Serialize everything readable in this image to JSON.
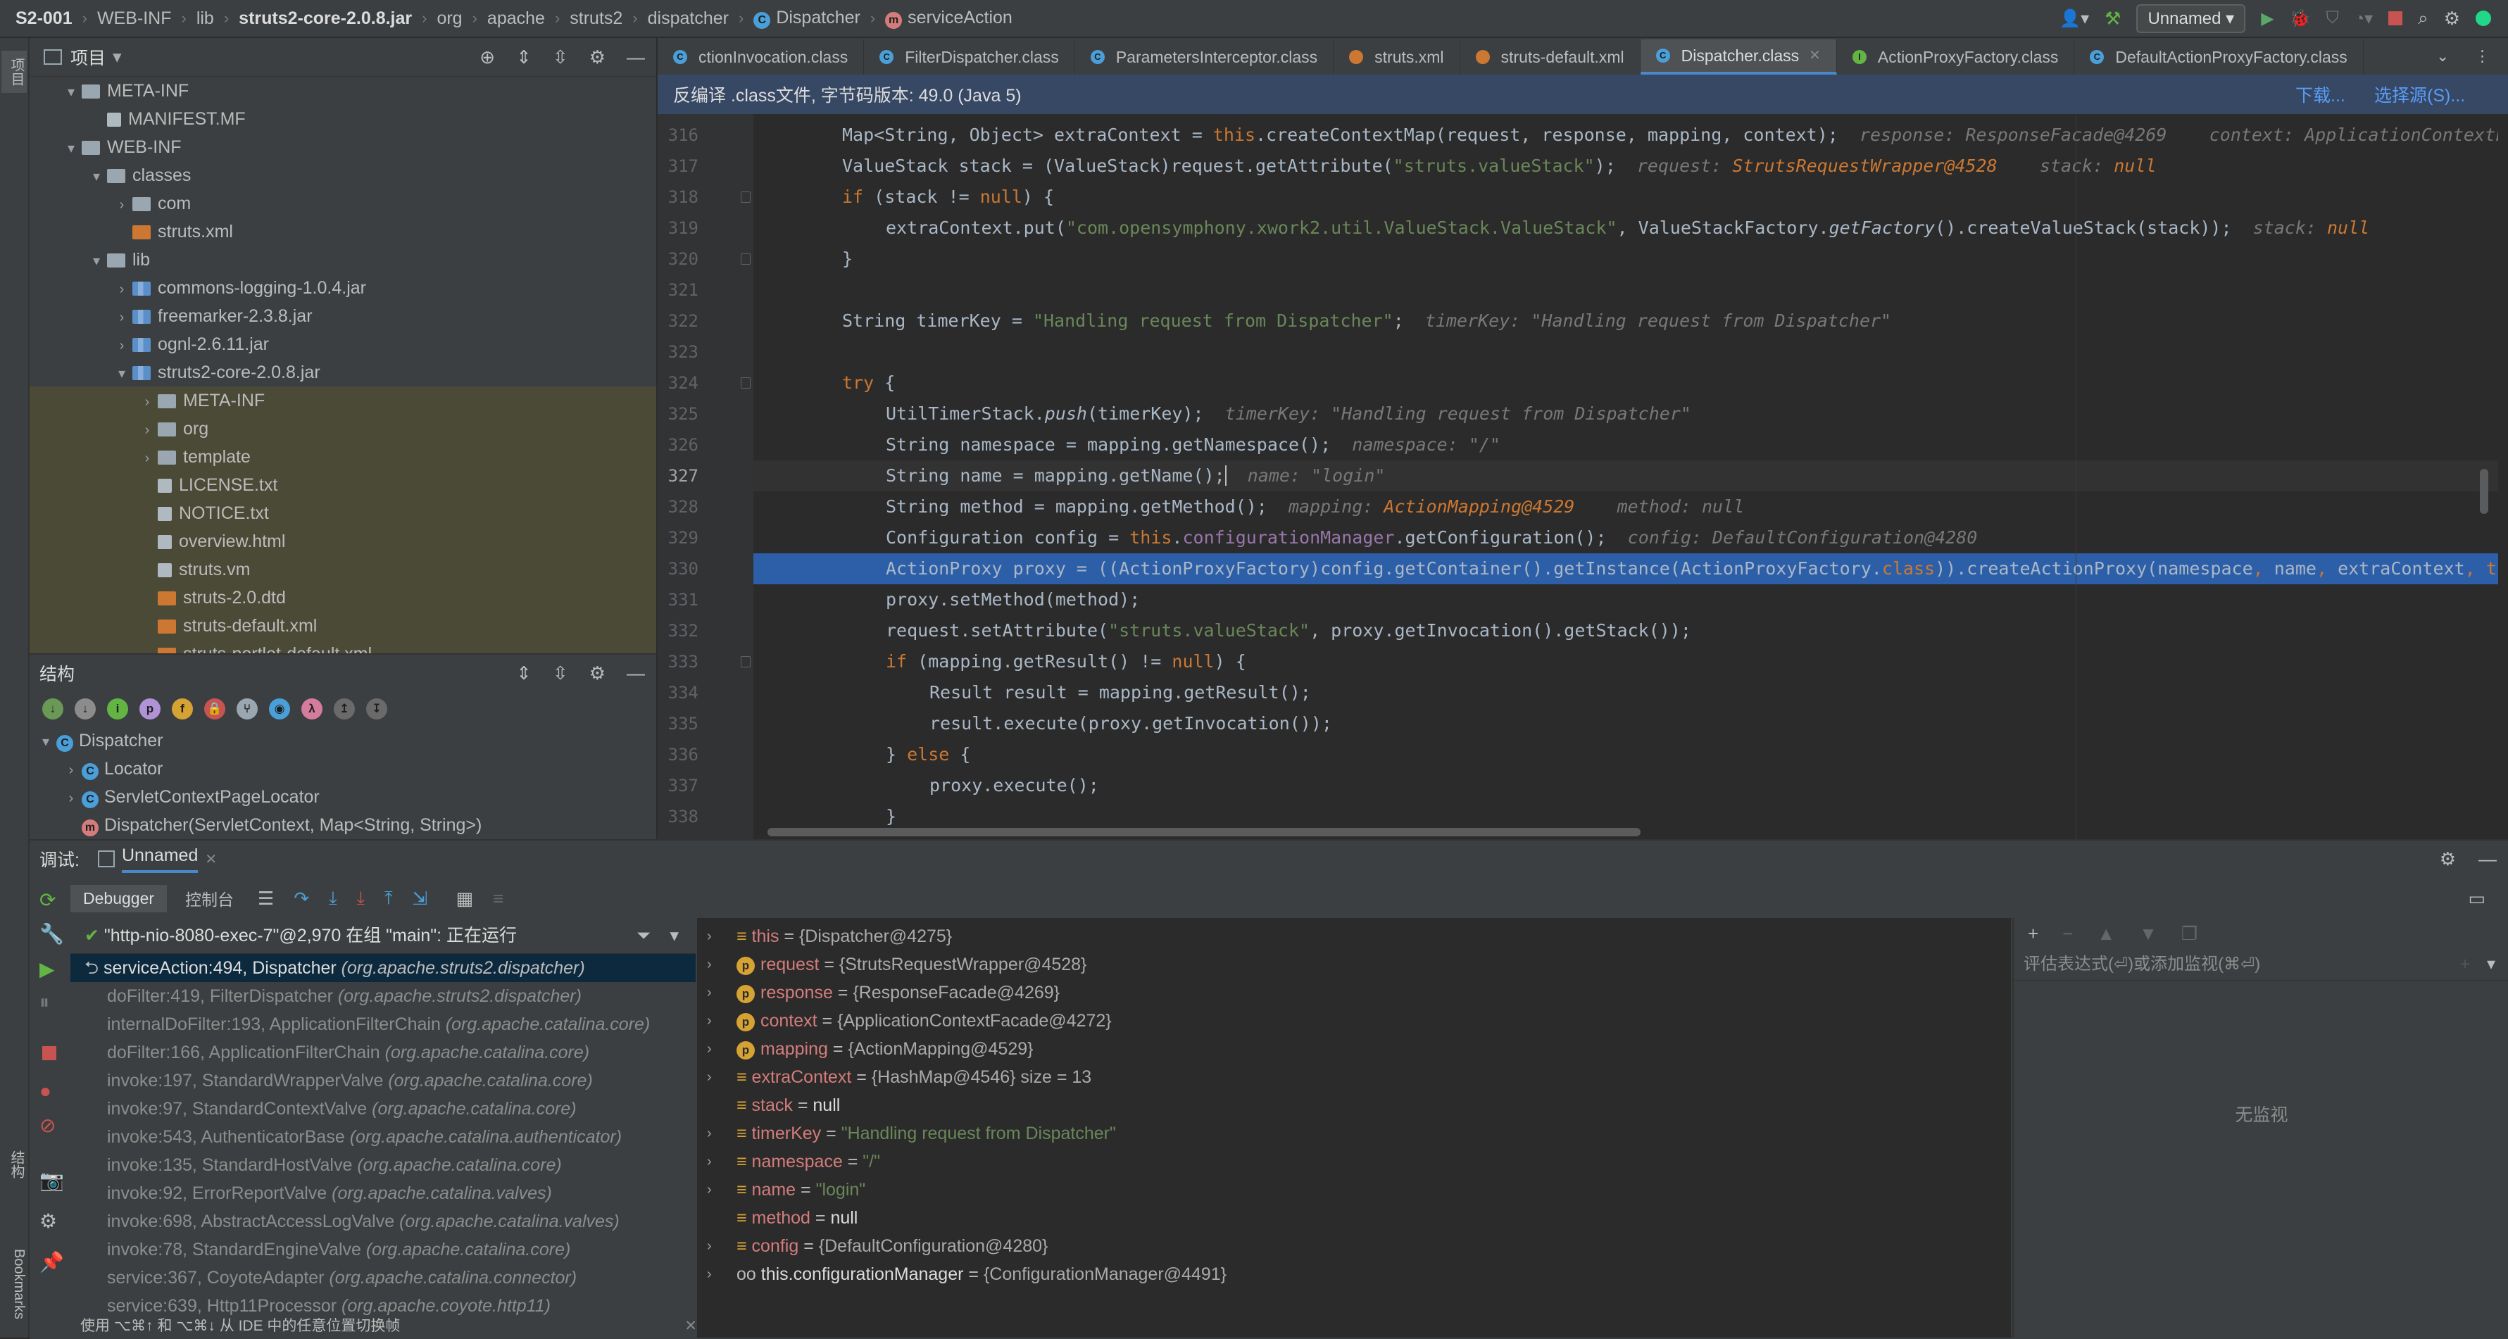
{
  "navbar": {
    "crumbs": [
      "S2-001",
      "WEB-INF",
      "lib",
      "struts2-core-2.0.8.jar",
      "org",
      "apache",
      "struts2",
      "dispatcher",
      "Dispatcher",
      "serviceAction"
    ],
    "run_config": "Unnamed"
  },
  "left_strip": {
    "project_label": "项目",
    "structure_label": "结构",
    "bookmarks_label": "Bookmarks"
  },
  "project": {
    "title": "项目",
    "tree": [
      {
        "label": "META-INF",
        "type": "folder",
        "depth": 1,
        "arrow": "▾"
      },
      {
        "label": "MANIFEST.MF",
        "type": "txt",
        "depth": 2,
        "arrow": ""
      },
      {
        "label": "WEB-INF",
        "type": "folder",
        "depth": 1,
        "arrow": "▾"
      },
      {
        "label": "classes",
        "type": "folder",
        "depth": 2,
        "arrow": "▾"
      },
      {
        "label": "com",
        "type": "folder",
        "depth": 3,
        "arrow": "›"
      },
      {
        "label": "struts.xml",
        "type": "xml",
        "depth": 3,
        "arrow": ""
      },
      {
        "label": "lib",
        "type": "folder",
        "depth": 2,
        "arrow": "▾"
      },
      {
        "label": "commons-logging-1.0.4.jar",
        "type": "jar",
        "depth": 3,
        "arrow": "›"
      },
      {
        "label": "freemarker-2.3.8.jar",
        "type": "jar",
        "depth": 3,
        "arrow": "›"
      },
      {
        "label": "ognl-2.6.11.jar",
        "type": "jar",
        "depth": 3,
        "arrow": "›"
      },
      {
        "label": "struts2-core-2.0.8.jar",
        "type": "jar",
        "depth": 3,
        "arrow": "▾"
      },
      {
        "label": "META-INF",
        "type": "folder",
        "depth": 4,
        "arrow": "›",
        "hl": true
      },
      {
        "label": "org",
        "type": "folder",
        "depth": 4,
        "arrow": "›",
        "hl": true
      },
      {
        "label": "template",
        "type": "folder",
        "depth": 4,
        "arrow": "›",
        "hl": true
      },
      {
        "label": "LICENSE.txt",
        "type": "txt",
        "depth": 4,
        "arrow": "",
        "hl": true
      },
      {
        "label": "NOTICE.txt",
        "type": "txt",
        "depth": 4,
        "arrow": "",
        "hl": true
      },
      {
        "label": "overview.html",
        "type": "txt",
        "depth": 4,
        "arrow": "",
        "hl": true
      },
      {
        "label": "struts.vm",
        "type": "txt",
        "depth": 4,
        "arrow": "",
        "hl": true
      },
      {
        "label": "struts-2.0.dtd",
        "type": "xml",
        "depth": 4,
        "arrow": "",
        "hl": true
      },
      {
        "label": "struts-default.xml",
        "type": "xml",
        "depth": 4,
        "arrow": "",
        "hl": true
      },
      {
        "label": "struts-portlet-default.xml",
        "type": "xml",
        "depth": 4,
        "arrow": "",
        "hl": true
      }
    ]
  },
  "structure": {
    "title": "结构",
    "tree": [
      {
        "label": "Dispatcher",
        "badge": "C",
        "depth": 0,
        "arrow": "▾"
      },
      {
        "label": "Locator",
        "badge": "C",
        "depth": 1,
        "arrow": "›"
      },
      {
        "label": "ServletContextPageLocator",
        "badge": "C",
        "depth": 1,
        "arrow": "›"
      },
      {
        "label": "Dispatcher(ServletContext, Map<String, String>)",
        "badge": "m",
        "depth": 1,
        "arrow": ""
      }
    ]
  },
  "editor": {
    "tabs": [
      {
        "label": "ctionInvocation.class",
        "color": "#4a9fd8",
        "active": false
      },
      {
        "label": "FilterDispatcher.class",
        "color": "#4a9fd8",
        "active": false
      },
      {
        "label": "ParametersInterceptor.class",
        "color": "#4a9fd8",
        "active": false
      },
      {
        "label": "struts.xml",
        "color": "#cc7832",
        "active": false
      },
      {
        "label": "struts-default.xml",
        "color": "#cc7832",
        "active": false
      },
      {
        "label": "Dispatcher.class",
        "color": "#4a9fd8",
        "active": true
      },
      {
        "label": "ActionProxyFactory.class",
        "color": "#62b543",
        "active": false
      },
      {
        "label": "DefaultActionProxyFactory.class",
        "color": "#4a9fd8",
        "active": false
      }
    ],
    "banner": {
      "message": "反编译 .class文件, 字节码版本: 49.0 (Java 5)",
      "download": "下载...",
      "choose_source": "选择源(S)..."
    },
    "current_line": "327",
    "highlight_line": "330"
  },
  "debug": {
    "title": "调试:",
    "session_tab": "Unnamed",
    "debugger_tab": "Debugger",
    "console_tab": "控制台",
    "thread": "\"http-nio-8080-exec-7\"@2,970 在组 \"main\": 正在运行",
    "frames": [
      {
        "m": "serviceAction:494, Dispatcher ",
        "p": "(org.apache.struts2.dispatcher)",
        "sel": true
      },
      {
        "m": "doFilter:419, FilterDispatcher ",
        "p": "(org.apache.struts2.dispatcher)"
      },
      {
        "m": "internalDoFilter:193, ApplicationFilterChain ",
        "p": "(org.apache.catalina.core)"
      },
      {
        "m": "doFilter:166, ApplicationFilterChain ",
        "p": "(org.apache.catalina.core)"
      },
      {
        "m": "invoke:197, StandardWrapperValve ",
        "p": "(org.apache.catalina.core)"
      },
      {
        "m": "invoke:97, StandardContextValve ",
        "p": "(org.apache.catalina.core)"
      },
      {
        "m": "invoke:543, AuthenticatorBase ",
        "p": "(org.apache.catalina.authenticator)"
      },
      {
        "m": "invoke:135, StandardHostValve ",
        "p": "(org.apache.catalina.core)"
      },
      {
        "m": "invoke:92, ErrorReportValve ",
        "p": "(org.apache.catalina.valves)"
      },
      {
        "m": "invoke:698, AbstractAccessLogValve ",
        "p": "(org.apache.catalina.valves)"
      },
      {
        "m": "invoke:78, StandardEngineValve ",
        "p": "(org.apache.catalina.core)"
      },
      {
        "m": "service:367, CoyoteAdapter ",
        "p": "(org.apache.catalina.connector)"
      },
      {
        "m": "service:639, Http11Processor ",
        "p": "(org.apache.coyote.http11)"
      }
    ],
    "variables": [
      {
        "name": "this",
        "value": "{Dispatcher@4275}",
        "badge": "",
        "exp": true
      },
      {
        "name": "request",
        "value": "{StrutsRequestWrapper@4528}",
        "badge": "p",
        "exp": true
      },
      {
        "name": "response",
        "value": "{ResponseFacade@4269}",
        "badge": "p",
        "exp": true
      },
      {
        "name": "context",
        "value": "{ApplicationContextFacade@4272}",
        "badge": "p",
        "exp": true
      },
      {
        "name": "mapping",
        "value": "{ActionMapping@4529}",
        "badge": "p",
        "exp": true
      },
      {
        "name": "extraContext",
        "value": "{HashMap@4546}  size = 13",
        "badge": "",
        "exp": true
      },
      {
        "name": "stack",
        "value": "null",
        "badge": "",
        "exp": false
      },
      {
        "name": "timerKey",
        "value": "\"Handling request from Dispatcher\"",
        "badge": "",
        "exp": true,
        "str": true
      },
      {
        "name": "namespace",
        "value": "\"/\"",
        "badge": "",
        "exp": true,
        "str": true
      },
      {
        "name": "name",
        "value": "\"login\"",
        "badge": "",
        "exp": true,
        "str": true
      },
      {
        "name": "method",
        "value": "null",
        "badge": "",
        "exp": false
      },
      {
        "name": "config",
        "value": "{DefaultConfiguration@4280}",
        "badge": "",
        "exp": true
      },
      {
        "name": "this.configurationManager",
        "value": "{ConfigurationManager@4491}",
        "badge": "oo",
        "exp": true
      }
    ],
    "watch_placeholder": "评估表达式(⏎)或添加监视(⌘⏎)",
    "no_watches": "无监视",
    "status": "使用 ⌥⌘↑ 和 ⌥⌘↓ 从 IDE 中的任意位置切换帧"
  }
}
